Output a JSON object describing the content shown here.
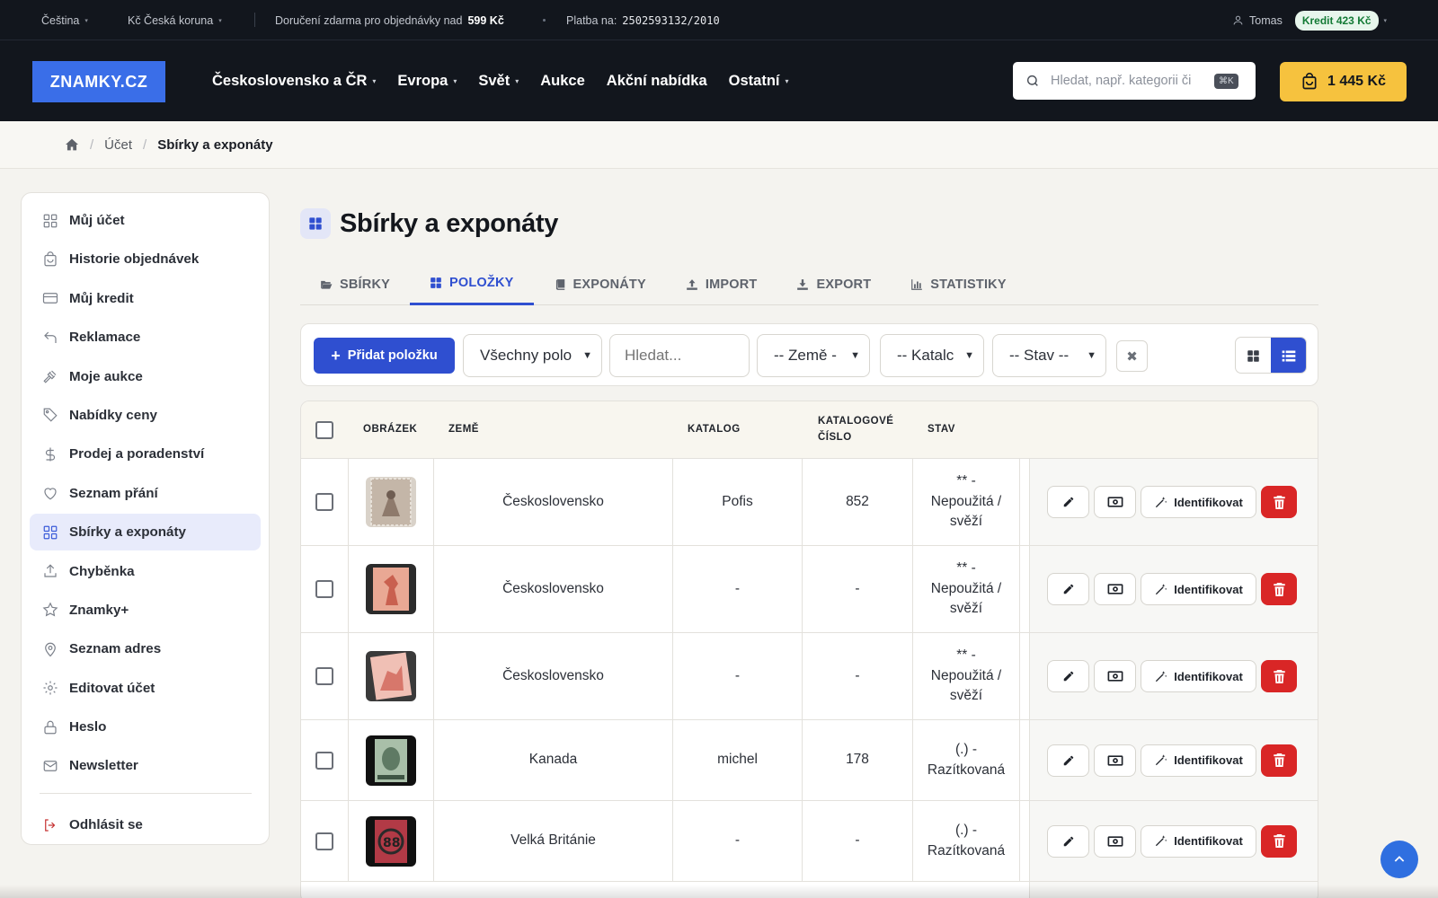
{
  "topbar": {
    "language": "Čeština",
    "currency": "Kč Česká koruna",
    "shipping_text": "Doručení zdarma pro objednávky nad",
    "shipping_amount": "599 Kč",
    "payment_label": "Platba na:",
    "payment_account": "2502593132/2010",
    "user_name": "Tomas",
    "credit": "Kredit 423 Kč"
  },
  "nav": {
    "logo": "ZNAMKY.CZ",
    "menu": [
      "Československo a ČR",
      "Evropa",
      "Svět",
      "Aukce",
      "Akční nabídka",
      "Ostatní"
    ],
    "search_placeholder": "Hledat, např. kategorii či",
    "search_shortcut": "⌘K",
    "cart_total": "1 445 Kč"
  },
  "breadcrumb": {
    "items": [
      "Účet",
      "Sbírky a exponáty"
    ]
  },
  "sidebar": {
    "items": [
      {
        "label": "Můj účet",
        "icon": "grid-icon"
      },
      {
        "label": "Historie objednávek",
        "icon": "bag-icon"
      },
      {
        "label": "Můj kredit",
        "icon": "card-icon"
      },
      {
        "label": "Reklamace",
        "icon": "return-icon"
      },
      {
        "label": "Moje aukce",
        "icon": "gavel-icon"
      },
      {
        "label": "Nabídky ceny",
        "icon": "tag-icon"
      },
      {
        "label": "Prodej a poradenství",
        "icon": "dollar-icon"
      },
      {
        "label": "Seznam přání",
        "icon": "heart-icon"
      },
      {
        "label": "Sbírky a exponáty",
        "icon": "grid-icon"
      },
      {
        "label": "Chyběnka",
        "icon": "upload-icon"
      },
      {
        "label": "Znamky+",
        "icon": "star-icon"
      },
      {
        "label": "Seznam adres",
        "icon": "pin-icon"
      },
      {
        "label": "Editovat účet",
        "icon": "gear-icon"
      },
      {
        "label": "Heslo",
        "icon": "lock-icon"
      },
      {
        "label": "Newsletter",
        "icon": "mail-icon"
      }
    ],
    "logout": "Odhlásit se"
  },
  "page": {
    "title": "Sbírky a exponáty",
    "tabs": [
      "SBÍRKY",
      "POLOŽKY",
      "EXPONÁTY",
      "IMPORT",
      "EXPORT",
      "STATISTIKY"
    ],
    "active_tab": "POLOŽKY"
  },
  "toolbar": {
    "add_label": "Přidat položku",
    "filter_all": "Všechny polo",
    "search_placeholder": "Hledat...",
    "country": "-- Země -",
    "catalog": "-- Katalc",
    "state": "-- Stav --"
  },
  "table": {
    "headers": {
      "image": "OBRÁZEK",
      "country": "ZEMĚ",
      "catalog": "KATALOG",
      "catalog_no_line1": "KATALOGOVÉ",
      "catalog_no_line2": "ČÍSLO",
      "state": "STAV"
    },
    "identify_label": "Identifikovat",
    "rows": [
      {
        "country": "Československo",
        "catalog": "Pofis",
        "number": "852",
        "state_l1": "** -",
        "state_l2": "Nepoužitá /",
        "state_l3": "svěží",
        "stamp_color": "#8e7a6c"
      },
      {
        "country": "Československo",
        "catalog": "-",
        "number": "-",
        "state_l1": "** -",
        "state_l2": "Nepoužitá /",
        "state_l3": "svěží",
        "stamp_color": "#c9604f"
      },
      {
        "country": "Československo",
        "catalog": "-",
        "number": "-",
        "state_l1": "** -",
        "state_l2": "Nepoužitá /",
        "state_l3": "svěží",
        "stamp_color": "#d7776b"
      },
      {
        "country": "Kanada",
        "catalog": "michel",
        "number": "178",
        "state_l1": "(.) -",
        "state_l2": "Razítkovaná",
        "state_l3": "",
        "stamp_color": "#5f7a64"
      },
      {
        "country": "Velká Británie",
        "catalog": "-",
        "number": "-",
        "state_l1": "(.) -",
        "state_l2": "Razítkovaná",
        "state_l3": "",
        "stamp_color": "#b23a46"
      }
    ]
  },
  "colors": {
    "accent": "#2f4fd0",
    "cart": "#f6c23e",
    "delete": "#d92626",
    "header_bg": "#12161d"
  }
}
